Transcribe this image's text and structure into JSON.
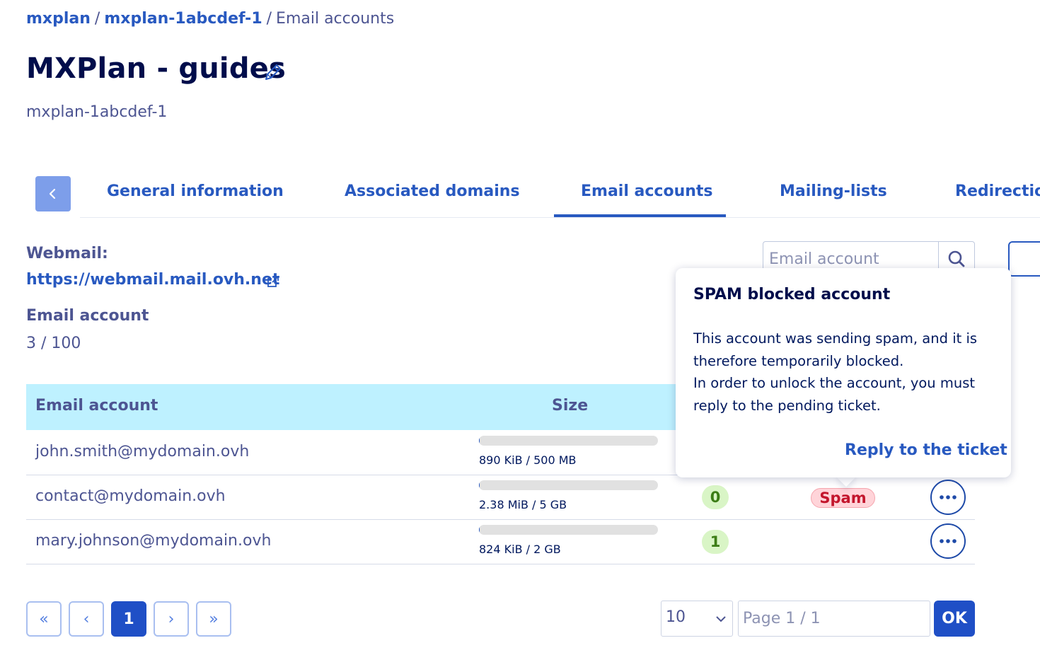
{
  "breadcrumb": {
    "items": [
      "mxplan",
      "mxplan-1abcdef-1"
    ],
    "separator": "/",
    "current": "Email accounts"
  },
  "header": {
    "title": "MXPlan - guides",
    "subtitle": "mxplan-1abcdef-1"
  },
  "tabs": [
    {
      "label": "General information",
      "active": false
    },
    {
      "label": "Associated domains",
      "active": false
    },
    {
      "label": "Email accounts",
      "active": true
    },
    {
      "label": "Mailing-lists",
      "active": false
    },
    {
      "label": "Redirections",
      "active": false
    }
  ],
  "webmail": {
    "label": "Webmail:",
    "url": "https://webmail.mail.ovh.net"
  },
  "accounts_summary": {
    "label": "Email account",
    "value": "3 / 100"
  },
  "search": {
    "placeholder": "Email account"
  },
  "table": {
    "columns": [
      "Email account",
      "Size"
    ],
    "rows": [
      {
        "email": "john.smith@mydomain.ovh",
        "size": "890 KiB / 500 MB",
        "usage": 0.0017,
        "count": null,
        "status": null
      },
      {
        "email": "contact@mydomain.ovh",
        "size": "2.38 MiB / 5 GB",
        "usage": 0.0005,
        "count": "0",
        "status": "Spam"
      },
      {
        "email": "mary.johnson@mydomain.ovh",
        "size": "824 KiB / 2 GB",
        "usage": 0.0004,
        "count": "1",
        "status": null
      }
    ]
  },
  "popover": {
    "title": "SPAM blocked account",
    "body_line1": "This account was sending spam, and it is therefore temporarily blocked.",
    "body_line2": "In order to unlock the account, you must reply to the pending ticket.",
    "link": "Reply to the ticket"
  },
  "pagination": {
    "first": "«",
    "prev": "‹",
    "current": "1",
    "next": "›",
    "last": "»",
    "page_size": "10",
    "page_placeholder": "Page 1 / 1",
    "ok_label": "OK"
  },
  "colors": {
    "primary": "#2859c0",
    "text": "#4d5592",
    "title": "#000d4b",
    "table_header": "#bef1ff",
    "spam_bg": "#ffd4d9",
    "spam_text": "#c3162d",
    "count_bg": "#d9f5c6",
    "count_text": "#3c7d16"
  },
  "icons": {
    "edit": "pencil-icon",
    "back": "chevron-left-icon",
    "external": "external-link-icon",
    "search": "search-icon",
    "actions": "ellipsis-icon",
    "select": "chevron-down-icon"
  }
}
